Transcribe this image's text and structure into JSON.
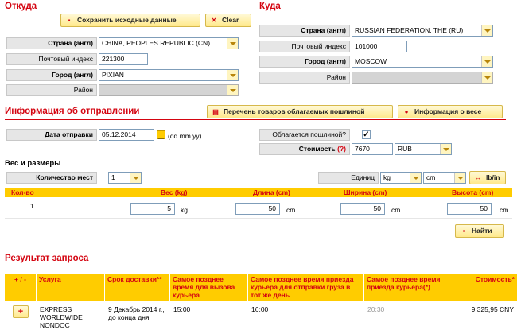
{
  "from": {
    "title": "Откуда",
    "save_button": "Сохранить исходные данные",
    "clear_button": "Clear",
    "country_label": "Страна (англ)",
    "country_value": "CHINA, PEOPLES REPUBLIC (CN)",
    "zip_label": "Почтовый индекс",
    "zip_value": "221300",
    "city_label": "Город (англ)",
    "city_value": "PIXIAN",
    "district_label": "Район",
    "district_value": ""
  },
  "to": {
    "title": "Куда",
    "country_label": "Страна (англ)",
    "country_value": "RUSSIAN FEDERATION, THE (RU)",
    "zip_label": "Почтовый индекс",
    "zip_value": "101000",
    "city_label": "Город (англ)",
    "city_value": "MOSCOW",
    "district_label": "Район",
    "district_value": ""
  },
  "shipment": {
    "title": "Информация об отправлении",
    "dutiable_list_button": "Перечень товаров облагаемых пошлиной",
    "weight_info_button": "Информация о весе",
    "date_label": "Дата отправки",
    "date_value": "05.12.2014",
    "date_format": "(dd.mm.yy)",
    "dutiable_label": "Облагается пошлиной?",
    "dutiable_checked": "✓",
    "cost_label": "Стоимость",
    "cost_hint": "(?)",
    "cost_value": "7670",
    "currency_value": "RUB"
  },
  "dimensions": {
    "title": "Вес и размеры",
    "pieces_label": "Количество мест",
    "pieces_value": "1",
    "units_label": "Единиц",
    "weight_unit": "kg",
    "length_unit": "cm",
    "toggle_button": "lb/in",
    "columns": {
      "qty": "Кол-во",
      "weight": "Вес (kg)",
      "length": "Длина (cm)",
      "width": "Ширина (cm)",
      "height": "Высота (cm)"
    },
    "row": {
      "num": "1.",
      "weight": "5",
      "weight_unit": "kg",
      "length": "50",
      "length_unit": "cm",
      "width": "50",
      "width_unit": "cm",
      "height": "50",
      "height_unit": "cm"
    },
    "search_button": "Найти"
  },
  "results": {
    "title": "Результат запроса",
    "columns": {
      "toggle": "+ / -",
      "service": "Услуга",
      "delivery": "Срок доставки**",
      "latest_call": "Самое позднее время для вызова курьера",
      "latest_pickup": "Самое позднее время приезда курьера для отправки груза в тот же день",
      "latest_arrival": "Самое позднее время приезда курьера(*)",
      "cost": "Стоимость*"
    },
    "row": {
      "toggle": "+",
      "service": "EXPRESS WORLDWIDE NONDOC",
      "delivery": "9 Декабрь 2014 г., до конца дня",
      "latest_call": "15:00",
      "latest_pickup": "16:00",
      "latest_arrival": "20:30",
      "cost": "9 325,95 CNY"
    }
  },
  "colors": {
    "accent": "#d40511",
    "header_yellow": "#ffcc00"
  }
}
